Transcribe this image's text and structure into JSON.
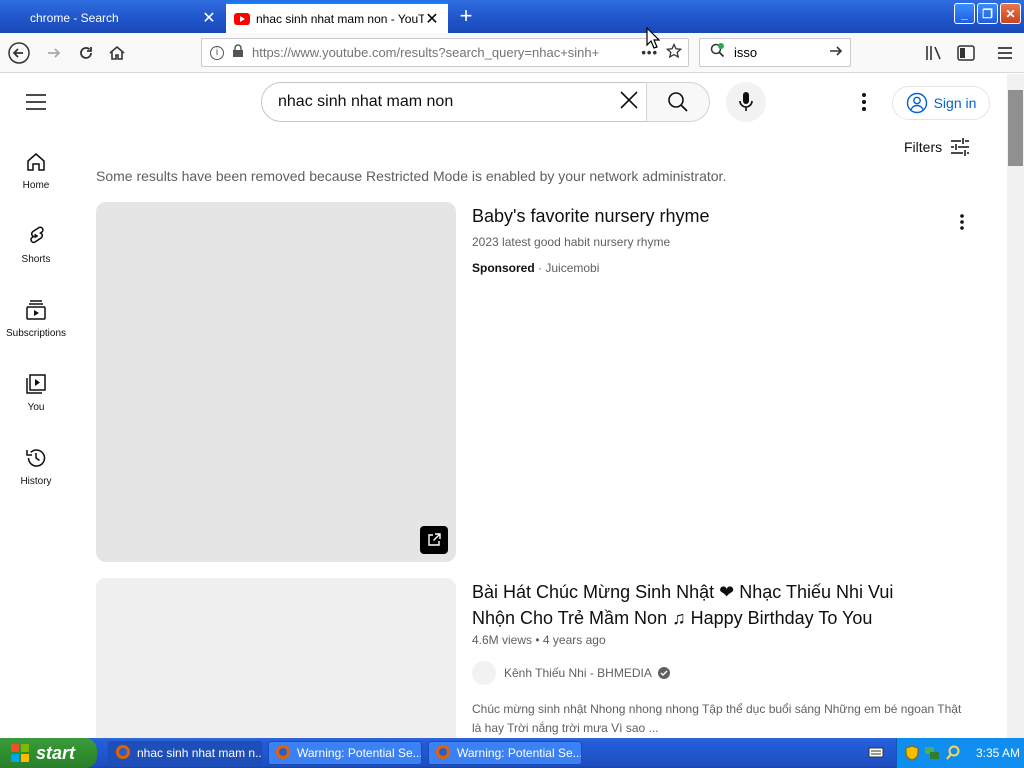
{
  "browser": {
    "tabs": [
      {
        "title": "chrome - Search",
        "active": false
      },
      {
        "title": "nhac sinh nhat mam non - YouTube",
        "active": true
      }
    ],
    "url": "https://www.youtube.com/results?search_query=nhac+sinh+",
    "search_value": "isso"
  },
  "youtube": {
    "search_query": "nhac sinh nhat mam non",
    "signin_label": "Sign in",
    "filters_label": "Filters",
    "guide": [
      {
        "label": "Home",
        "icon": "home-icon"
      },
      {
        "label": "Shorts",
        "icon": "shorts-icon"
      },
      {
        "label": "Subscriptions",
        "icon": "subscriptions-icon"
      },
      {
        "label": "You",
        "icon": "you-icon"
      },
      {
        "label": "History",
        "icon": "history-icon"
      }
    ],
    "restricted_notice": "Some results have been removed because Restricted Mode is enabled by your network administrator.",
    "results": [
      {
        "title": "Baby's favorite nursery rhyme",
        "subtitle": "2023 latest good habit nursery rhyme",
        "sponsored_label": "Sponsored",
        "advertiser": "Juicemobi"
      },
      {
        "title_line1": "Bài Hát Chúc Mừng Sinh Nhật ❤ Nhạc Thiếu Nhi Vui",
        "title_line2": "Nhộn Cho Trẻ Mầm Non ♫ Happy Birthday To You",
        "views": "4.6M views",
        "age": "4 years ago",
        "channel": "Kênh Thiếu Nhi - BHMEDIA",
        "description_line1": "Chúc mừng sinh nhật Nhong nhong nhong Tập thể dục buổi sáng Những em bé ngoan Thật",
        "description_line2": "là hay Trời nắng trời mưa Vì sao ..."
      }
    ]
  },
  "taskbar": {
    "start_label": "start",
    "tasks": [
      {
        "label": "nhac sinh nhat mam n...",
        "active": true
      },
      {
        "label": "Warning: Potential Se...",
        "active": false
      },
      {
        "label": "Warning: Potential Se...",
        "active": false
      }
    ],
    "clock": "3:35 AM"
  },
  "colors": {
    "accent": "#065fd4",
    "yt_red": "#ff0000",
    "taskbar": "#245edb",
    "start": "#2f8f2f"
  }
}
